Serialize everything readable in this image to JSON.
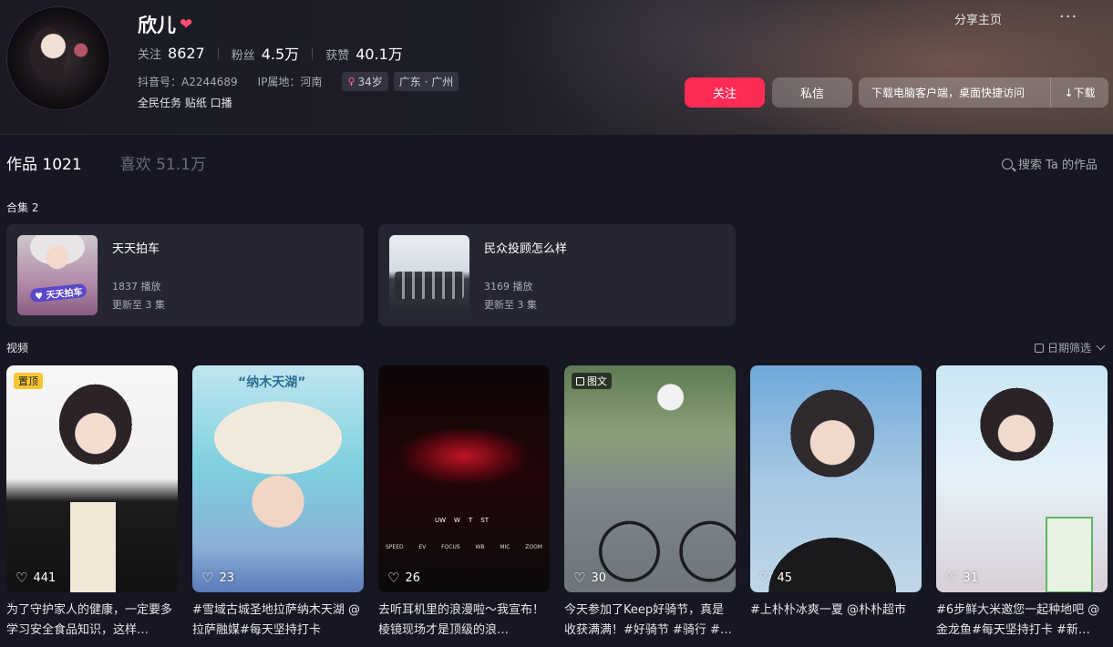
{
  "profile": {
    "name": "欣儿",
    "heart_icon": "heart-emoji-icon",
    "stats": [
      {
        "label": "关注",
        "value": "8627"
      },
      {
        "label": "粉丝",
        "value": "4.5万"
      },
      {
        "label": "获赞",
        "value": "40.1万"
      }
    ],
    "douyin_id": "抖音号：A2244689",
    "ip": "IP属地：河南",
    "age": "34岁",
    "location": "广东 · 广州",
    "bio": "全民任务 贴纸 口播"
  },
  "header_actions": {
    "share": "分享主页",
    "more": "···",
    "follow": "关注",
    "message": "私信",
    "download_tip": "下载电脑客户端，桌面快捷访问",
    "download": "↓下载"
  },
  "tabs": [
    {
      "label": "作品 1021",
      "active": true
    },
    {
      "label": "喜欢 51.1万",
      "active": false
    }
  ],
  "search_placeholder": "搜索 Ta 的作品",
  "collections_label": "合集 2",
  "collections": [
    {
      "title": "天天拍车",
      "plays": "1837 播放",
      "update": "更新至 3 集",
      "cover_text": "♥ 天天拍车"
    },
    {
      "title": "民众投顾怎么样",
      "plays": "3169 播放",
      "update": "更新至 3 集"
    }
  ],
  "videos_label": "视频",
  "date_filter": "日期筛选",
  "videos": [
    {
      "likes": "441",
      "badge": "置顶",
      "desc": "为了守护家人的健康，一定要多学习安全食品知识，这样…"
    },
    {
      "likes": "23",
      "cover_text": "“纳木天湖”",
      "desc": "#雪域古城圣地拉萨纳木天湖 @拉萨融媒#每天坚持打卡"
    },
    {
      "likes": "26",
      "hud": [
        "SPEED",
        "EV",
        "FOCUS",
        "WB",
        "MIC",
        "ZOOM"
      ],
      "hud2": [
        "UW",
        "W",
        "T",
        "ST"
      ],
      "desc": "去听耳机里的浪漫啦～我宣布！棱镜现场才是顶级的浪…"
    },
    {
      "likes": "30",
      "badge": "图文",
      "desc": "今天参加了Keep好骑节，真是收获满满！#好骑节 #骑行 #…"
    },
    {
      "likes": "45",
      "desc": "#上朴朴冰爽一夏 @朴朴超市"
    },
    {
      "likes": "31",
      "desc": "#6步鲜大米邀您一起种地吧 @金龙鱼#每天坚持打卡 #新…"
    }
  ],
  "colors": {
    "background": "#161722",
    "accent": "#fe2c55",
    "card": "#252632"
  }
}
